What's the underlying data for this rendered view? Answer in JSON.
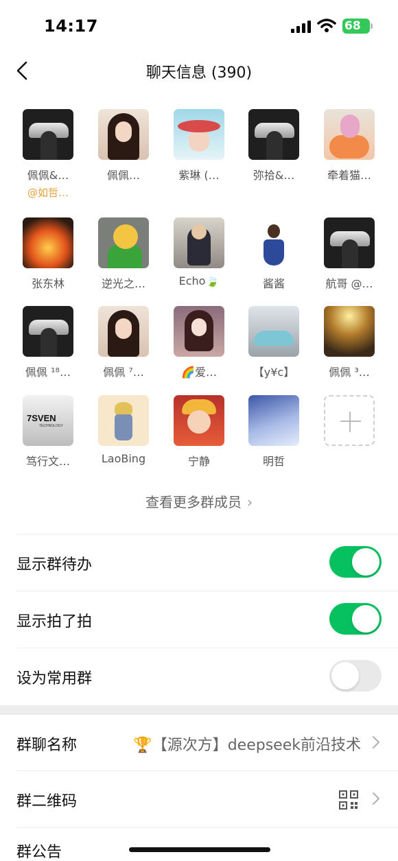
{
  "status_bar": {
    "time": "14:17",
    "battery": "68"
  },
  "header": {
    "title": "聊天信息 (390)",
    "back_icon": "chevron-left-icon"
  },
  "members": [
    {
      "name": "佩佩&…",
      "note": "@如哲…",
      "avatar": "car-window"
    },
    {
      "name": "佩佩…",
      "avatar": "girl"
    },
    {
      "name": "紫琳 (…",
      "avatar": "hat"
    },
    {
      "name": "弥拾&…",
      "avatar": "car-window"
    },
    {
      "name": "牵着猫…",
      "avatar": "pig"
    },
    {
      "name": "张东林",
      "avatar": "fire"
    },
    {
      "name": "逆光之…",
      "avatar": "cartoon"
    },
    {
      "name": "Echo🍃",
      "avatar": "kid"
    },
    {
      "name": "酱酱",
      "avatar": "doll"
    },
    {
      "name": "航哥 @…",
      "avatar": "car-window"
    },
    {
      "name": "佩佩 ¹⁸…",
      "avatar": "car-window"
    },
    {
      "name": "佩佩 ⁷…",
      "avatar": "girl"
    },
    {
      "name": "🌈爱…",
      "avatar": "anime"
    },
    {
      "name": "【y¥c】",
      "avatar": "porsche"
    },
    {
      "name": "佩佩 ³…",
      "avatar": "sunray"
    },
    {
      "name": "笃行文…",
      "avatar": "logo",
      "logo_text": "7SVEN",
      "logo_sub": "TECHNOLOGY"
    },
    {
      "name": "LaoBing",
      "avatar": "sketch"
    },
    {
      "name": "宁静",
      "avatar": "lion"
    },
    {
      "name": "明哲",
      "avatar": "sky"
    }
  ],
  "add_member_icon": "plus-icon",
  "see_more": {
    "label": "查看更多群成员",
    "icon": "chevron-right-icon"
  },
  "settings": {
    "show_todo": {
      "label": "显示群待办",
      "enabled": true
    },
    "show_pat": {
      "label": "显示拍了拍",
      "enabled": true
    },
    "set_frequent": {
      "label": "设为常用群",
      "enabled": false
    },
    "group_name": {
      "label": "群聊名称",
      "value": "🏆【源次方】deepseek前沿技术"
    },
    "group_qr": {
      "label": "群二维码",
      "icon": "qr-code-icon"
    },
    "announcement": {
      "label": "群公告"
    }
  },
  "colors": {
    "toggle_on": "#07c160",
    "note_text": "#e6a23c"
  }
}
